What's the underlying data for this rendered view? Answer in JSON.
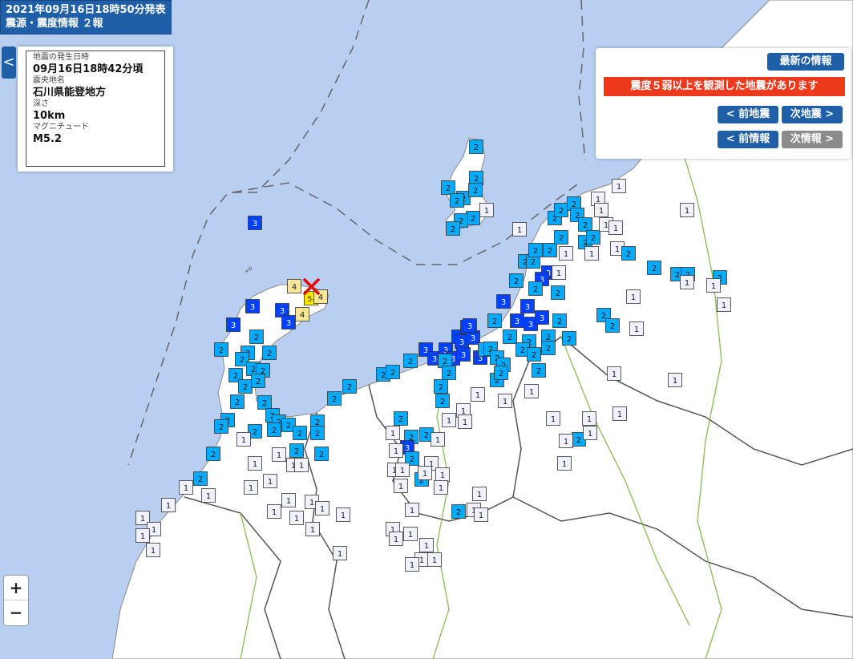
{
  "header": {
    "line1": "2021年09月16日18時50分発表",
    "line2": "震源・震度情報 ２報"
  },
  "info": {
    "time_label": "地震の発生日時",
    "time_value": "09月16日18時42分頃",
    "place_label": "震央地名",
    "place_value": "石川県能登地方",
    "depth_label": "深さ",
    "depth_value": "10km",
    "magnitude_label": "マグニチュード",
    "magnitude_value": "M5.2"
  },
  "controls": {
    "latest": "最新の情報",
    "alert": "震度５弱以上を観測した地震があります",
    "prev_quake": "< 前地震",
    "next_quake": "次地震 >",
    "prev_info": "< 前情報",
    "next_info": "次情報 >"
  },
  "collapse": "<",
  "zoom": {
    "in": "+",
    "out": "−"
  },
  "colors": {
    "sea": "#b9cff2",
    "land": "#ffffff",
    "i1": "#f2f2ff",
    "i2": "#00aaff",
    "i3": "#0041ff",
    "i4": "#fae696",
    "i5lower": "#ffe600",
    "epicenter": "#e60000"
  },
  "legend_intensity_codes": {
    "1": "1",
    "2": "2",
    "3": "3",
    "4": "4",
    "5-": "5-"
  }
}
